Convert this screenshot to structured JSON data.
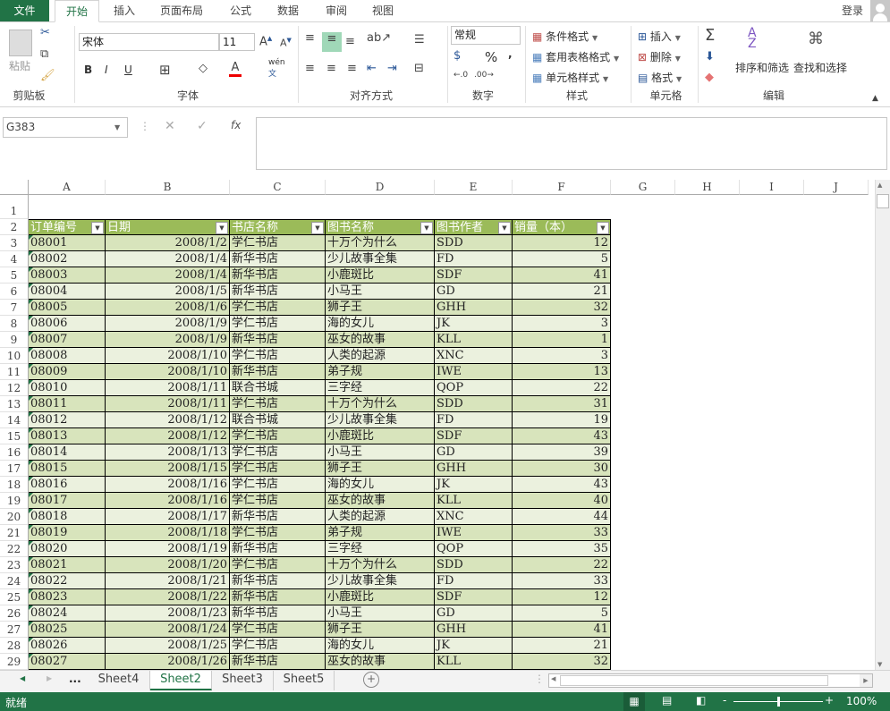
{
  "tabs": {
    "file": "文件",
    "items": [
      "开始",
      "插入",
      "页面布局",
      "公式",
      "数据",
      "审阅",
      "视图"
    ],
    "login": "登录"
  },
  "ribbon": {
    "clipboard": {
      "paste": "粘贴",
      "label": "剪贴板"
    },
    "font": {
      "name": "宋体",
      "size": "11",
      "bold": "B",
      "italic": "I",
      "underline": "U",
      "phonetic_top": "wén",
      "phonetic_bottom": "文",
      "label": "字体"
    },
    "alignment": {
      "label": "对齐方式"
    },
    "number": {
      "format": "常规",
      "percent": "%",
      "comma": ",",
      "label": "数字"
    },
    "styles": {
      "conditional": "条件格式",
      "table": "套用表格格式",
      "cell": "单元格样式",
      "label": "样式"
    },
    "cells": {
      "insert": "插入",
      "delete": "删除",
      "format": "格式",
      "label": "单元格"
    },
    "editing": {
      "sort": "排序和筛选",
      "find": "查找和选择",
      "label": "编辑"
    }
  },
  "formula_bar": {
    "name_box": "G383",
    "fx": "fx",
    "formula": ""
  },
  "columns": [
    "A",
    "B",
    "C",
    "D",
    "E",
    "F",
    "G",
    "H",
    "I",
    "J"
  ],
  "table": {
    "headers": [
      "订单编号",
      "日期",
      "书店名称",
      "图书名称",
      "图书作者",
      "销量（本）"
    ],
    "rows": [
      [
        "08001",
        "2008/1/2",
        "学仁书店",
        "十万个为什么",
        "SDD",
        "12"
      ],
      [
        "08002",
        "2008/1/4",
        "新华书店",
        "少儿故事全集",
        "FD",
        "5"
      ],
      [
        "08003",
        "2008/1/4",
        "新华书店",
        "小鹿斑比",
        "SDF",
        "41"
      ],
      [
        "08004",
        "2008/1/5",
        "新华书店",
        "小马王",
        "GD",
        "21"
      ],
      [
        "08005",
        "2008/1/6",
        "学仁书店",
        "狮子王",
        "GHH",
        "32"
      ],
      [
        "08006",
        "2008/1/9",
        "学仁书店",
        "海的女儿",
        "JK",
        "3"
      ],
      [
        "08007",
        "2008/1/9",
        "新华书店",
        "巫女的故事",
        "KLL",
        "1"
      ],
      [
        "08008",
        "2008/1/10",
        "学仁书店",
        "人类的起源",
        "XNC",
        "3"
      ],
      [
        "08009",
        "2008/1/10",
        "新华书店",
        "弟子规",
        "IWE",
        "13"
      ],
      [
        "08010",
        "2008/1/11",
        "联合书城",
        "三字经",
        "QOP",
        "22"
      ],
      [
        "08011",
        "2008/1/11",
        "学仁书店",
        "十万个为什么",
        "SDD",
        "31"
      ],
      [
        "08012",
        "2008/1/12",
        "联合书城",
        "少儿故事全集",
        "FD",
        "19"
      ],
      [
        "08013",
        "2008/1/12",
        "学仁书店",
        "小鹿斑比",
        "SDF",
        "43"
      ],
      [
        "08014",
        "2008/1/13",
        "学仁书店",
        "小马王",
        "GD",
        "39"
      ],
      [
        "08015",
        "2008/1/15",
        "学仁书店",
        "狮子王",
        "GHH",
        "30"
      ],
      [
        "08016",
        "2008/1/16",
        "学仁书店",
        "海的女儿",
        "JK",
        "43"
      ],
      [
        "08017",
        "2008/1/16",
        "学仁书店",
        "巫女的故事",
        "KLL",
        "40"
      ],
      [
        "08018",
        "2008/1/17",
        "新华书店",
        "人类的起源",
        "XNC",
        "44"
      ],
      [
        "08019",
        "2008/1/18",
        "学仁书店",
        "弟子规",
        "IWE",
        "33"
      ],
      [
        "08020",
        "2008/1/19",
        "新华书店",
        "三字经",
        "QOP",
        "35"
      ],
      [
        "08021",
        "2008/1/20",
        "学仁书店",
        "十万个为什么",
        "SDD",
        "22"
      ],
      [
        "08022",
        "2008/1/21",
        "新华书店",
        "少儿故事全集",
        "FD",
        "33"
      ],
      [
        "08023",
        "2008/1/22",
        "新华书店",
        "小鹿斑比",
        "SDF",
        "12"
      ],
      [
        "08024",
        "2008/1/23",
        "新华书店",
        "小马王",
        "GD",
        "5"
      ],
      [
        "08025",
        "2008/1/24",
        "学仁书店",
        "狮子王",
        "GHH",
        "41"
      ],
      [
        "08026",
        "2008/1/25",
        "学仁书店",
        "海的女儿",
        "JK",
        "21"
      ],
      [
        "08027",
        "2008/1/26",
        "新华书店",
        "巫女的故事",
        "KLL",
        "32"
      ]
    ]
  },
  "sheets": {
    "more": "...",
    "items": [
      "Sheet4",
      "Sheet2",
      "Sheet3",
      "Sheet5"
    ],
    "active": "Sheet2"
  },
  "status": {
    "ready": "就绪",
    "zoom": "100%",
    "zoom_level": 100
  },
  "colors": {
    "brand": "#217346",
    "header": "#9bbb59",
    "band_odd": "#d8e4bc",
    "band_even": "#ebf1de"
  }
}
